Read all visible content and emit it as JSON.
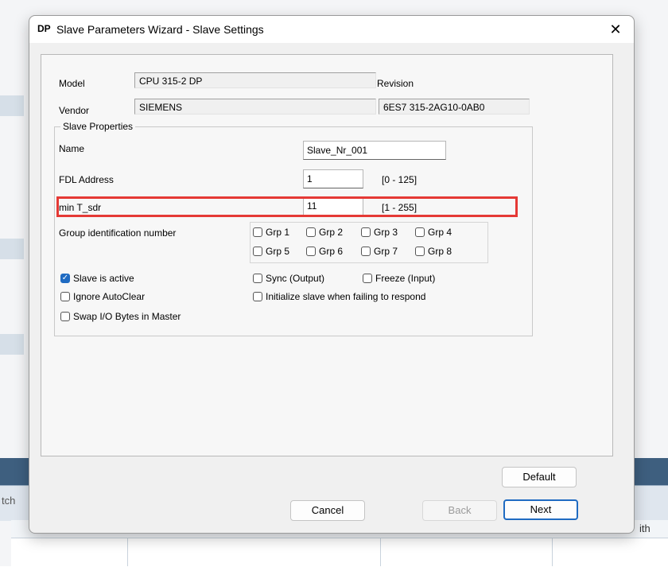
{
  "background": {
    "left_text": "tch",
    "right_text": "ith"
  },
  "dialog": {
    "icon_text": "DP",
    "title": "Slave Parameters Wizard - Slave Settings",
    "close_glyph": "✕"
  },
  "info": {
    "model_label": "Model",
    "model_value": "CPU 315-2 DP",
    "revision_label": "Revision",
    "vendor_label": "Vendor",
    "vendor_value": "SIEMENS",
    "order_number_value": "6ES7 315-2AG10-0AB0"
  },
  "slave_properties": {
    "legend": "Slave Properties",
    "name_label": "Name",
    "name_value": "Slave_Nr_001",
    "fdl_label": "FDL Address",
    "fdl_value": "1",
    "fdl_range": "[0 - 125]",
    "tsdr_label": "min T_sdr",
    "tsdr_value": "11",
    "tsdr_range": "[1 - 255]",
    "group_label": "Group identification number",
    "groups": [
      {
        "label": "Grp 1",
        "checked": false
      },
      {
        "label": "Grp 2",
        "checked": false
      },
      {
        "label": "Grp 3",
        "checked": false
      },
      {
        "label": "Grp 4",
        "checked": false
      },
      {
        "label": "Grp 5",
        "checked": false
      },
      {
        "label": "Grp 6",
        "checked": false
      },
      {
        "label": "Grp 7",
        "checked": false
      },
      {
        "label": "Grp 8",
        "checked": false
      }
    ],
    "options": {
      "slave_active": {
        "label": "Slave is active",
        "checked": true
      },
      "ignore_autoclear": {
        "label": "Ignore AutoClear",
        "checked": false
      },
      "swap_io": {
        "label": "Swap I/O Bytes in Master",
        "checked": false
      },
      "sync_output": {
        "label": "Sync (Output)",
        "checked": false
      },
      "freeze_input": {
        "label": "Freeze (Input)",
        "checked": false
      },
      "init_slave": {
        "label": "Initialize slave when failing to respond",
        "checked": false
      }
    }
  },
  "buttons": {
    "default": "Default",
    "cancel": "Cancel",
    "back": "Back",
    "next": "Next"
  },
  "colors": {
    "highlight": "#e53935",
    "accent": "#1f6bc2"
  }
}
